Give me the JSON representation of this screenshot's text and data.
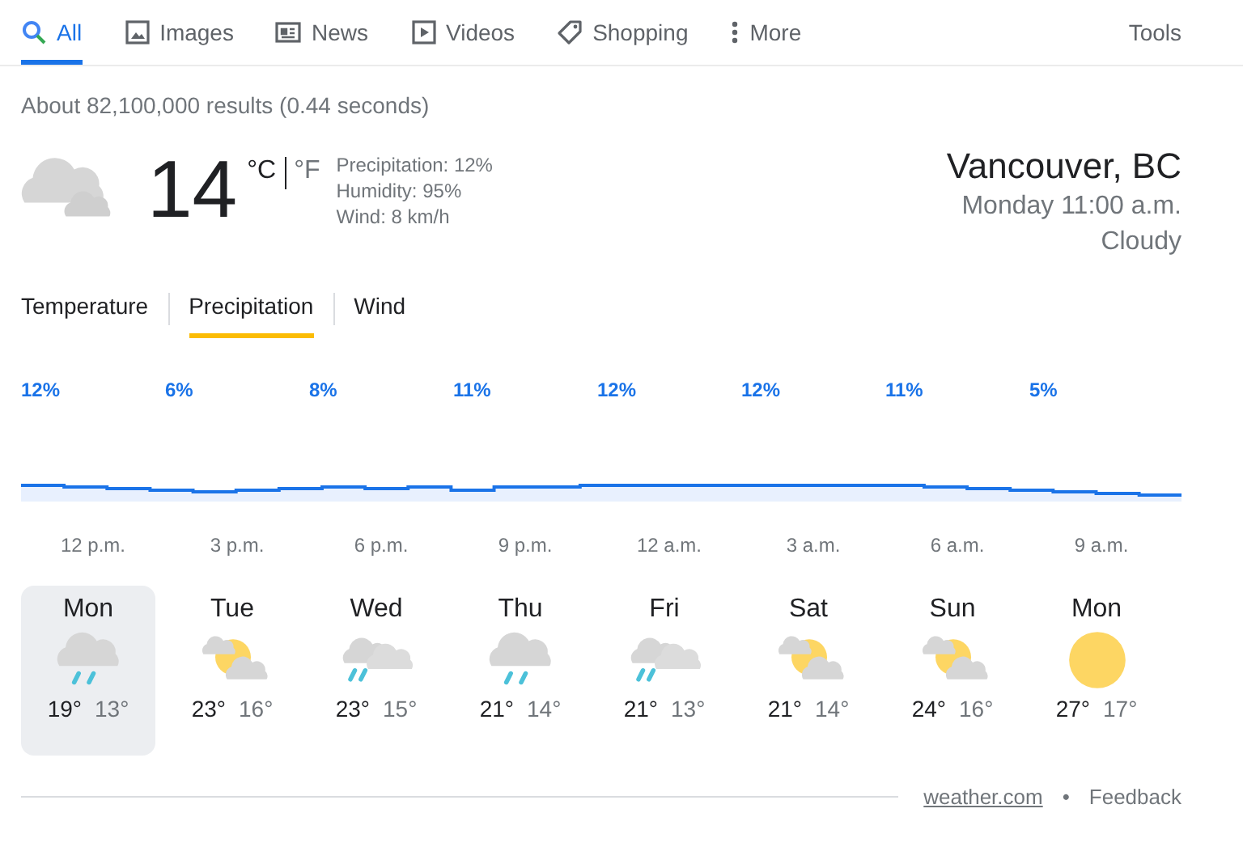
{
  "nav": [
    {
      "label": "All",
      "kind": "search",
      "selected": true
    },
    {
      "label": "Images",
      "kind": "image",
      "selected": false
    },
    {
      "label": "News",
      "kind": "news",
      "selected": false
    },
    {
      "label": "Videos",
      "kind": "play",
      "selected": false
    },
    {
      "label": "Shopping",
      "kind": "tag",
      "selected": false
    },
    {
      "label": "More",
      "kind": "dots",
      "selected": false
    }
  ],
  "tools": "Tools",
  "result_stats": "About 82,100,000 results (0.44 seconds)",
  "current": {
    "temperature": "14",
    "unit_c": "°C",
    "unit_f": "°F",
    "unit_c_selected": true,
    "precipitation": "Precipitation: 12%",
    "humidity": "Humidity: 95%",
    "wind": "Wind: 8 km/h",
    "location": "Vancouver, BC",
    "time": "Monday 11:00 a.m.",
    "condition": "Cloudy",
    "kind": "cloudy"
  },
  "chart_tabs": [
    {
      "label": "Temperature",
      "selected": false
    },
    {
      "label": "Precipitation",
      "selected": true
    },
    {
      "label": "Wind",
      "selected": false
    }
  ],
  "hourly": [
    {
      "value": "12%",
      "time": "12 p.m."
    },
    {
      "value": "6%",
      "time": "3 p.m."
    },
    {
      "value": "8%",
      "time": "6 p.m."
    },
    {
      "value": "11%",
      "time": "9 p.m."
    },
    {
      "value": "12%",
      "time": "12 a.m."
    },
    {
      "value": "12%",
      "time": "3 a.m."
    },
    {
      "value": "11%",
      "time": "6 a.m."
    },
    {
      "value": "5%",
      "time": "9 a.m."
    }
  ],
  "days": [
    {
      "day": "Mon",
      "kind": "rain",
      "high": "19°",
      "low": "13°",
      "selected": true
    },
    {
      "day": "Tue",
      "kind": "partly_cloudy",
      "high": "23°",
      "low": "16°",
      "selected": false
    },
    {
      "day": "Wed",
      "kind": "scattered_showers",
      "high": "23°",
      "low": "15°",
      "selected": false
    },
    {
      "day": "Thu",
      "kind": "rain",
      "high": "21°",
      "low": "14°",
      "selected": false
    },
    {
      "day": "Fri",
      "kind": "scattered_showers",
      "high": "21°",
      "low": "13°",
      "selected": false
    },
    {
      "day": "Sat",
      "kind": "partly_cloudy",
      "high": "21°",
      "low": "14°",
      "selected": false
    },
    {
      "day": "Sun",
      "kind": "partly_cloudy",
      "high": "24°",
      "low": "16°",
      "selected": false
    },
    {
      "day": "Mon",
      "kind": "sunny",
      "high": "27°",
      "low": "17°",
      "selected": false
    }
  ],
  "footer": {
    "source": "weather.com",
    "separator": "•",
    "feedback": "Feedback"
  }
}
